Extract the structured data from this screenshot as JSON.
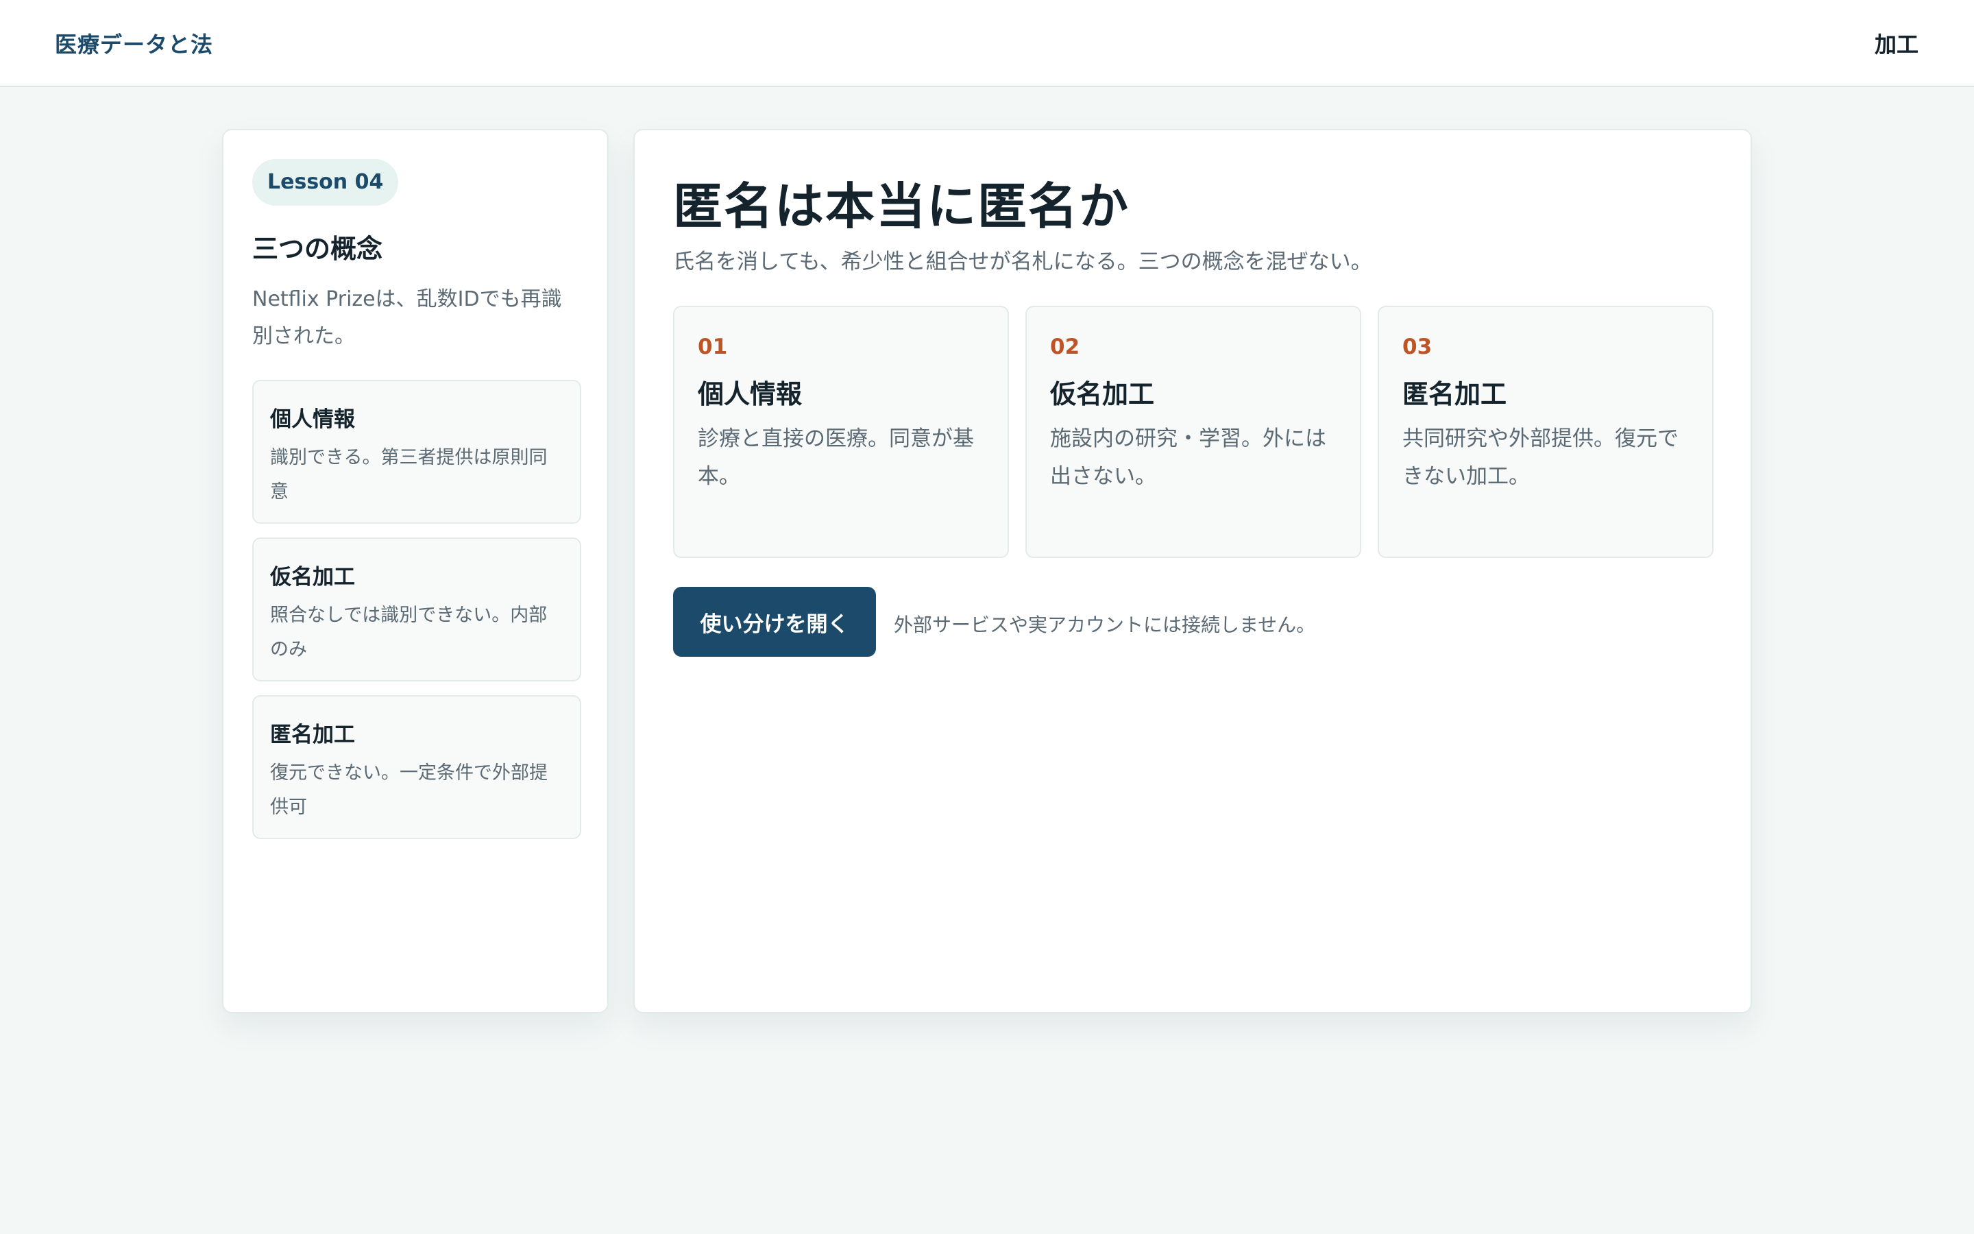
{
  "header": {
    "brand": "医療データと法",
    "nav_label": "加工"
  },
  "sidebar": {
    "badge": "Lesson 04",
    "title": "三つの概念",
    "description": "Netflix Prizeは、乱数IDでも再識別された。",
    "items": [
      {
        "title": "個人情報",
        "description": "識別できる。第三者提供は原則同意"
      },
      {
        "title": "仮名加工",
        "description": "照合なしでは識別できない。内部のみ"
      },
      {
        "title": "匿名加工",
        "description": "復元できない。一定条件で外部提供可"
      }
    ]
  },
  "main": {
    "title": "匿名は本当に匿名か",
    "subtitle": "氏名を消しても、希少性と組合せが名札になる。三つの概念を混ぜない。",
    "steps": [
      {
        "number": "01",
        "title": "個人情報",
        "description": "診療と直接の医療。同意が基本。"
      },
      {
        "number": "02",
        "title": "仮名加工",
        "description": "施設内の研究・学習。外には出さない。"
      },
      {
        "number": "03",
        "title": "匿名加工",
        "description": "共同研究や外部提供。復元できない加工。"
      }
    ],
    "button_label": "使い分けを開く",
    "note": "外部サービスや実アカウントには接続しません。"
  },
  "colors": {
    "brand": "#1c4a6a",
    "accent": "#bd5426",
    "background": "#f3f7f6"
  }
}
